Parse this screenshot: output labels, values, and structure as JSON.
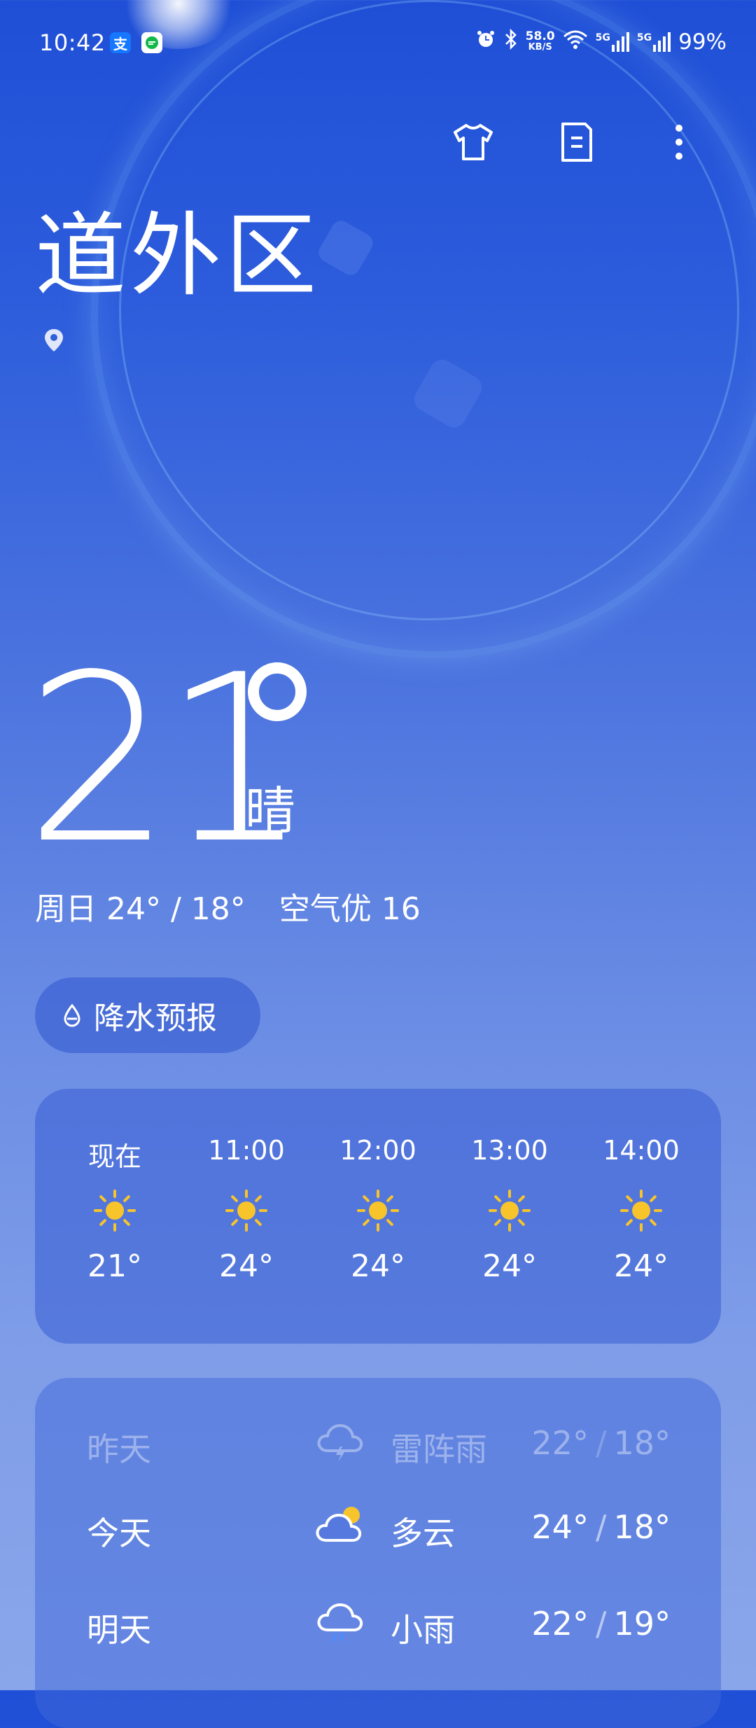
{
  "status_bar": {
    "time": "10:42",
    "apps": [
      "支",
      "信"
    ],
    "network_speed": "58.0",
    "network_speed_unit": "KB/S",
    "sim1": "5G",
    "sim2": "5G",
    "battery": "99%"
  },
  "location": {
    "name": "道外区"
  },
  "current": {
    "temperature": "21",
    "condition": "晴",
    "summary_day": "周日 24° / 18°",
    "summary_air": "空气优 16"
  },
  "precip_button": {
    "label": "降水预报"
  },
  "hourly": [
    {
      "time": "现在",
      "icon": "sun-icon",
      "temp": "21°"
    },
    {
      "time": "11:00",
      "icon": "sun-icon",
      "temp": "24°"
    },
    {
      "time": "12:00",
      "icon": "sun-icon",
      "temp": "24°"
    },
    {
      "time": "13:00",
      "icon": "sun-icon",
      "temp": "24°"
    },
    {
      "time": "14:00",
      "icon": "sun-icon",
      "temp": "24°"
    }
  ],
  "daily": [
    {
      "day": "昨天",
      "icon": "thunderstorm-icon",
      "condition": "雷阵雨",
      "high": "22°",
      "low": "18°"
    },
    {
      "day": "今天",
      "icon": "partly-cloudy-icon",
      "condition": "多云",
      "high": "24°",
      "low": "18°"
    },
    {
      "day": "明天",
      "icon": "light-rain-icon",
      "condition": "小雨",
      "high": "22°",
      "low": "19°"
    }
  ],
  "colors": {
    "sun": "#f8c42b",
    "background_top": "#1f4fd6",
    "background_bottom": "#8aa6ea"
  }
}
